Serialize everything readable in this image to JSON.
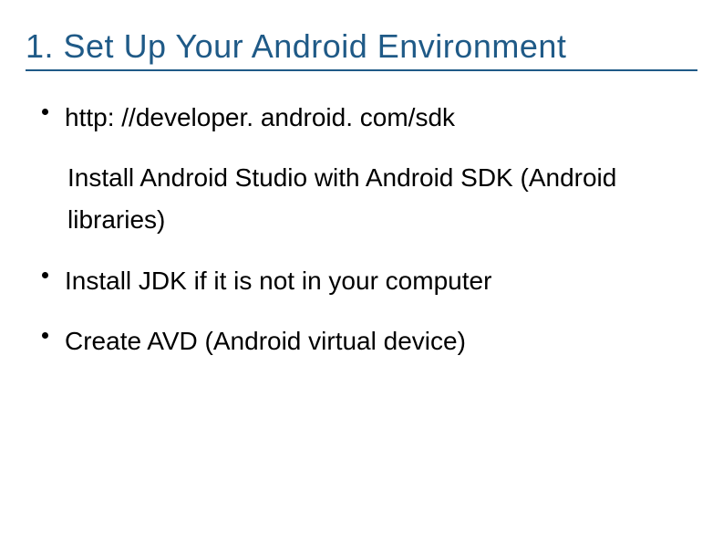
{
  "slide": {
    "title": "1. Set Up Your Android Environment",
    "items": [
      {
        "text": "http: //developer. android. com/sdk",
        "sub": "Install Android Studio with Android SDK (Android libraries)"
      },
      {
        "text": "Install JDK if it is not in your computer"
      },
      {
        "text": "Create AVD (Android virtual device)"
      }
    ]
  }
}
